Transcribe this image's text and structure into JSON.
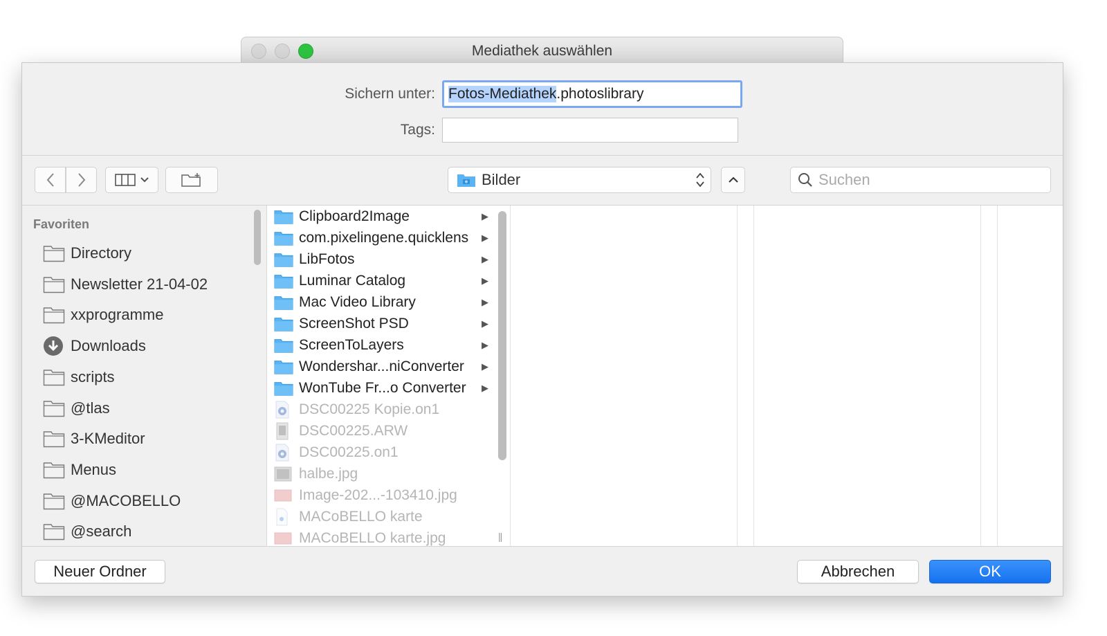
{
  "window": {
    "title": "Mediathek auswählen"
  },
  "form": {
    "save_label": "Sichern unter:",
    "filename_selected": "Fotos-Mediathek",
    "filename_rest": ".photoslibrary",
    "tags_label": "Tags:",
    "tags_value": ""
  },
  "toolbar": {
    "location": "Bilder",
    "search_placeholder": "Suchen"
  },
  "sidebar": {
    "header": "Favoriten",
    "items": [
      {
        "label": "Directory",
        "icon": "folder-icon"
      },
      {
        "label": "Newsletter 21-04-02",
        "icon": "folder-icon"
      },
      {
        "label": "xxprogramme",
        "icon": "folder-icon"
      },
      {
        "label": "Downloads",
        "icon": "download-icon"
      },
      {
        "label": "scripts",
        "icon": "folder-icon"
      },
      {
        "label": "@tlas",
        "icon": "folder-icon"
      },
      {
        "label": "3-KMeditor",
        "icon": "folder-icon"
      },
      {
        "label": "Menus",
        "icon": "folder-icon"
      },
      {
        "label": "@MACOBELLO",
        "icon": "folder-icon"
      },
      {
        "label": "@search",
        "icon": "folder-icon"
      }
    ]
  },
  "files": [
    {
      "name": "Clipboard2Image",
      "kind": "folder",
      "enabled": true
    },
    {
      "name": "com.pixelingene.quicklens",
      "kind": "folder",
      "enabled": true
    },
    {
      "name": "LibFotos",
      "kind": "folder",
      "enabled": true
    },
    {
      "name": "Luminar Catalog",
      "kind": "folder",
      "enabled": true
    },
    {
      "name": "Mac Video Library",
      "kind": "folder",
      "enabled": true
    },
    {
      "name": "ScreenShot PSD",
      "kind": "folder",
      "enabled": true
    },
    {
      "name": "ScreenToLayers",
      "kind": "folder",
      "enabled": true
    },
    {
      "name": "Wondershar...niConverter",
      "kind": "folder",
      "enabled": true
    },
    {
      "name": "WonTube Fr...o Converter",
      "kind": "folder",
      "enabled": true
    },
    {
      "name": "DSC00225 Kopie.on1",
      "kind": "on1",
      "enabled": false
    },
    {
      "name": "DSC00225.ARW",
      "kind": "raw",
      "enabled": false
    },
    {
      "name": "DSC00225.on1",
      "kind": "on1",
      "enabled": false
    },
    {
      "name": "halbe.jpg",
      "kind": "image",
      "enabled": false
    },
    {
      "name": "Image-202...-103410.jpg",
      "kind": "image-red",
      "enabled": false
    },
    {
      "name": "MACoBELLO karte",
      "kind": "doc",
      "enabled": false
    },
    {
      "name": "MACoBELLO karte.jpg",
      "kind": "image-red",
      "enabled": false
    }
  ],
  "buttons": {
    "new_folder": "Neuer Ordner",
    "cancel": "Abbrechen",
    "ok": "OK"
  },
  "colors": {
    "accent": "#1672f0",
    "folder_blue": "#5ab3f3",
    "zoom_green": "#2ec440"
  }
}
